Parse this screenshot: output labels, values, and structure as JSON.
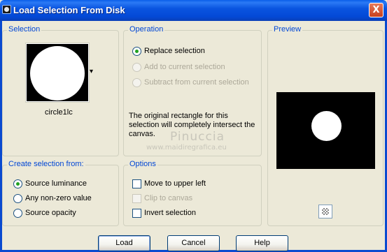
{
  "window": {
    "title": "Load Selection From Disk",
    "close_glyph": "X"
  },
  "selection_group": {
    "label": "Selection",
    "thumbnail_name": "circle1lc",
    "dropdown_glyph": "▾"
  },
  "operation_group": {
    "label": "Operation",
    "options": [
      {
        "label": "Replace selection",
        "checked": true,
        "enabled": true
      },
      {
        "label": "Add to current selection",
        "checked": false,
        "enabled": false
      },
      {
        "label": "Subtract from current selection",
        "checked": false,
        "enabled": false
      }
    ],
    "note": "The original rectangle for this selection will completely intersect the canvas."
  },
  "preview_group": {
    "label": "Preview"
  },
  "create_group": {
    "label": "Create selection from:",
    "options": [
      {
        "label": "Source luminance",
        "checked": true
      },
      {
        "label": "Any non-zero value",
        "checked": false
      },
      {
        "label": "Source opacity",
        "checked": false
      }
    ]
  },
  "options_group": {
    "label": "Options",
    "checks": [
      {
        "label": "Move to upper left",
        "checked": false,
        "enabled": true
      },
      {
        "label": "Clip to canvas",
        "checked": false,
        "enabled": false
      },
      {
        "label": "Invert selection",
        "checked": false,
        "enabled": true
      }
    ]
  },
  "watermark": {
    "line1": "Pinuccia",
    "line2": "www.maidiregrafica.eu"
  },
  "buttons": {
    "load": "Load",
    "cancel": "Cancel",
    "help": "Help"
  },
  "icons": {
    "app": "selection-app-icon",
    "zoom": "preview-zoom-icon"
  }
}
